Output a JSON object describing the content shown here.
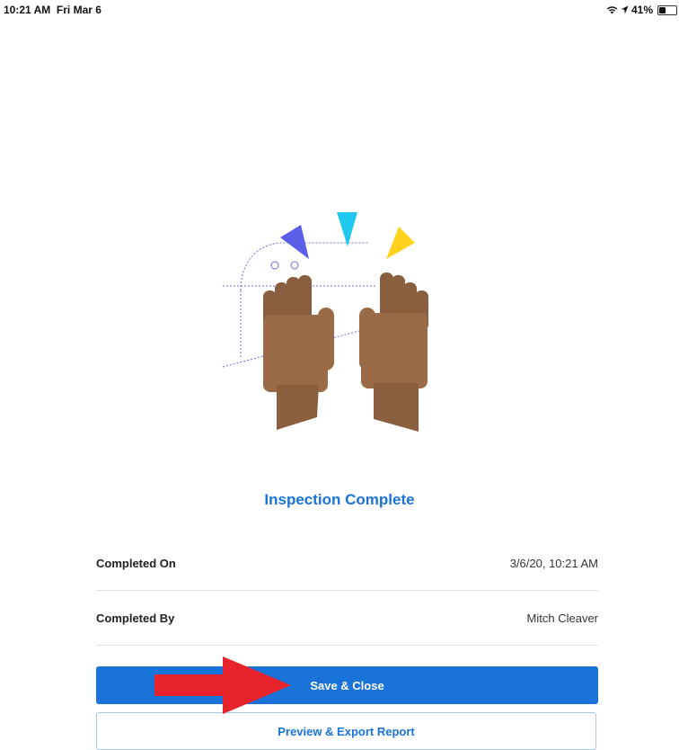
{
  "status": {
    "time": "10:21 AM",
    "date": "Fri Mar 6",
    "battery_text": "41%",
    "battery_level": 0.41
  },
  "main": {
    "title": "Inspection Complete",
    "details": [
      {
        "label": "Completed On",
        "value": "3/6/20, 10:21 AM"
      },
      {
        "label": "Completed By",
        "value": "Mitch Cleaver"
      }
    ]
  },
  "actions": {
    "save_label": "Save & Close",
    "preview_label": "Preview & Export Report"
  },
  "colors": {
    "accent": "#1a73d9",
    "annotation_arrow": "#e8222a"
  }
}
